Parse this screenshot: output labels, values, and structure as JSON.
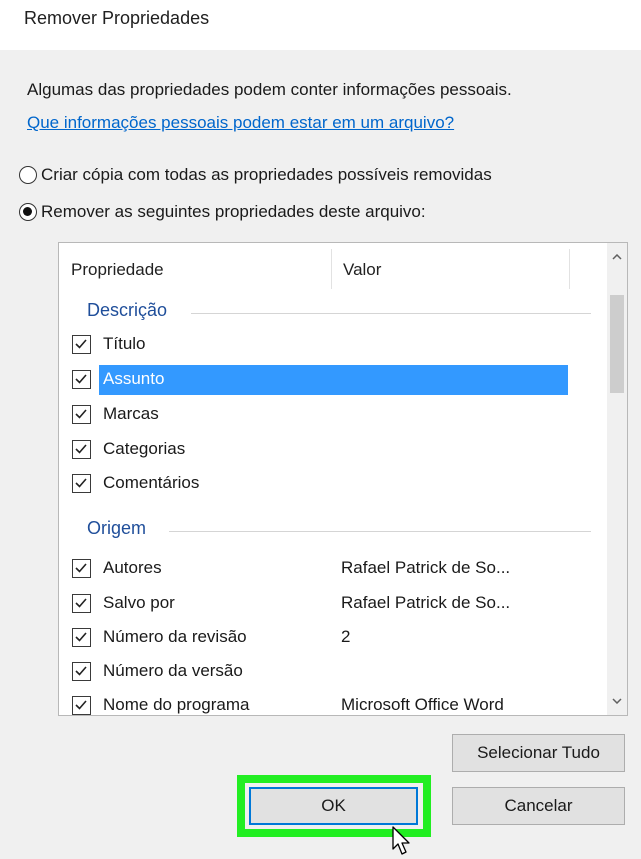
{
  "window": {
    "title": "Remover Propriedades"
  },
  "info": {
    "text": "Algumas das propriedades podem conter informações pessoais.",
    "link": "Que informações pessoais podem estar em um arquivo?"
  },
  "options": {
    "copy_label": "Criar cópia com todas as propriedades possíveis removidas",
    "remove_label": "Remover as seguintes propriedades deste arquivo:",
    "selected": "remove"
  },
  "list": {
    "columns": [
      "Propriedade",
      "Valor"
    ],
    "groups": [
      {
        "title": "Descrição",
        "rows": [
          {
            "name": "Título",
            "value": "",
            "checked": true,
            "selected": false
          },
          {
            "name": "Assunto",
            "value": "",
            "checked": true,
            "selected": true
          },
          {
            "name": "Marcas",
            "value": "",
            "checked": true,
            "selected": false
          },
          {
            "name": "Categorias",
            "value": "",
            "checked": true,
            "selected": false
          },
          {
            "name": "Comentários",
            "value": "",
            "checked": true,
            "selected": false
          }
        ]
      },
      {
        "title": "Origem",
        "rows": [
          {
            "name": "Autores",
            "value": "Rafael Patrick de So...",
            "checked": true,
            "selected": false
          },
          {
            "name": "Salvo por",
            "value": "Rafael Patrick de So...",
            "checked": true,
            "selected": false
          },
          {
            "name": "Número da revisão",
            "value": "2",
            "checked": true,
            "selected": false
          },
          {
            "name": "Número da versão",
            "value": "",
            "checked": true,
            "selected": false
          },
          {
            "name": "Nome do programa",
            "value": "Microsoft Office Word",
            "checked": true,
            "selected": false
          }
        ]
      }
    ]
  },
  "buttons": {
    "select_all": "Selecionar Tudo",
    "ok": "OK",
    "cancel": "Cancelar"
  },
  "colors": {
    "selection": "#3399ff",
    "link": "#0066cc",
    "group_title": "#1f4e9a",
    "highlight": "#22ee22"
  }
}
